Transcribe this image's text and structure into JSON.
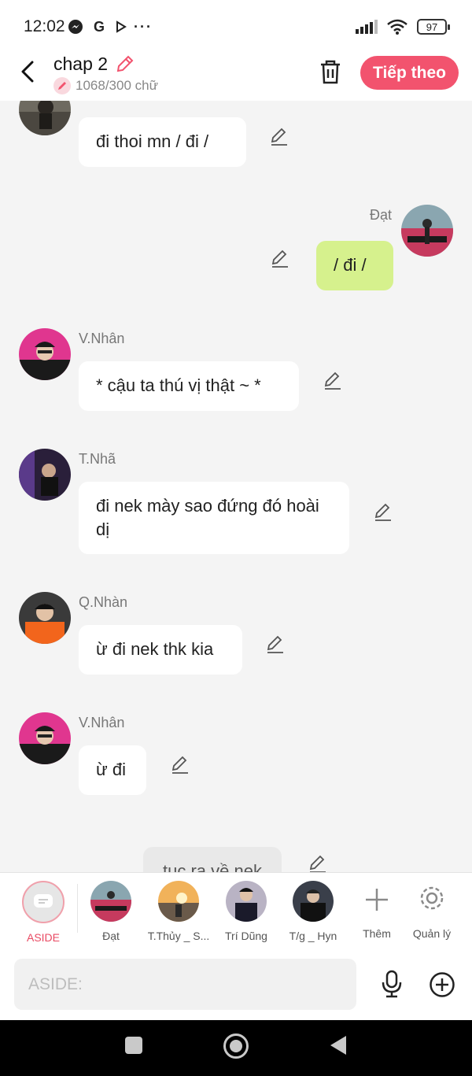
{
  "status": {
    "time": "12:02",
    "battery": "97"
  },
  "header": {
    "title": "chap 2",
    "word_count": "1068/300 chữ",
    "next_label": "Tiếp theo"
  },
  "messages": [
    {
      "sender": "",
      "text": "đi thoi mn / đi /",
      "side": "left"
    },
    {
      "sender": "Đạt",
      "text": "/ đi /",
      "side": "right"
    },
    {
      "sender": "V.Nhân",
      "text": "* cậu ta thú vị thật ~ *",
      "side": "left"
    },
    {
      "sender": "T.Nhã",
      "text": "đi nek mày sao đứng đó hoài dị",
      "side": "left"
    },
    {
      "sender": "Q.Nhàn",
      "text": "ừ đi nek thk kia",
      "side": "left"
    },
    {
      "sender": "V.Nhân",
      "text": "ừ đi",
      "side": "left"
    },
    {
      "sender": "",
      "text": "tuc ra về nek",
      "side": "aside"
    }
  ],
  "characters": [
    {
      "name": "ASIDE"
    },
    {
      "name": "Đạt"
    },
    {
      "name": "T.Thủy _ S..."
    },
    {
      "name": "Trí Dũng"
    },
    {
      "name": "T/g _ Hyn"
    },
    {
      "name": "Thêm"
    },
    {
      "name": "Quản lý"
    }
  ],
  "input": {
    "placeholder": "ASIDE:"
  },
  "colors": {
    "accent": "#f2536e",
    "my_bubble": "#d6f18d",
    "aside_label": "#e94a63"
  }
}
